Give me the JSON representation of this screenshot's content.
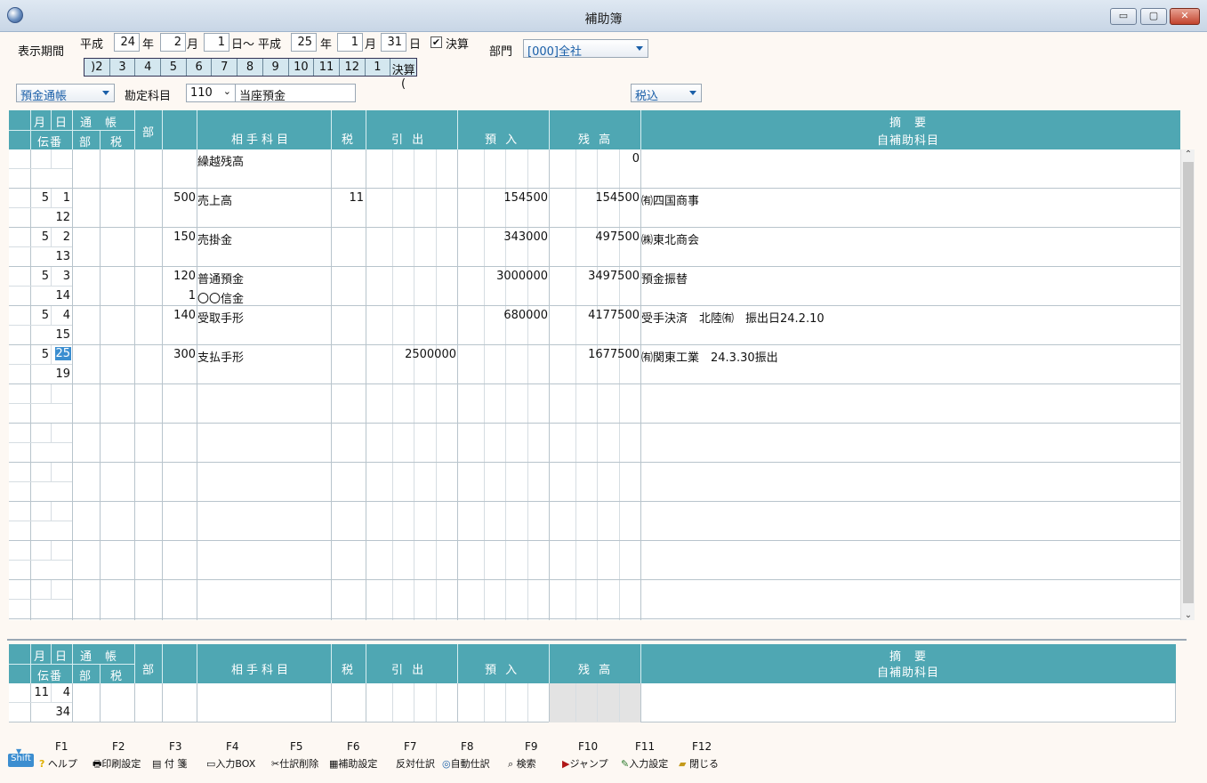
{
  "window": {
    "title": "補助簿",
    "min_glyph": "▭",
    "max_glyph": "▢",
    "close_glyph": "✕"
  },
  "period": {
    "label": "表示期間",
    "era1": "平成",
    "year1": "24",
    "year_unit": "年",
    "month1": "2",
    "month_unit": "月",
    "day1": "1",
    "day_unit": "日～",
    "era2": "平成",
    "year2": "25",
    "month2": "1",
    "day2": "31",
    "day_unit2": "日",
    "settle_checked": "✔",
    "settle_label": "決算"
  },
  "months": [
    ")2",
    "3",
    "4",
    "5",
    "6",
    "7",
    "8",
    "9",
    "10",
    "11",
    "12",
    "1",
    "決算("
  ],
  "department": {
    "label": "部門",
    "value": "[000]全社"
  },
  "ledger_type": "預金通帳",
  "account": {
    "label": "勘定科目",
    "code": "110",
    "name": "当座預金"
  },
  "tax_mode": "税込",
  "headers": {
    "month": "月",
    "day": "日",
    "passbook": "通　帳",
    "slip": "伝番",
    "dept_sub": "部",
    "tax_sub": "税",
    "dept": "部",
    "counter_account": "相手科目",
    "tax": "税",
    "withdraw": "引 出",
    "deposit": "預 入",
    "balance": "残 高",
    "memo": "摘　要",
    "sub_account": "自補助科目"
  },
  "rows": [
    {
      "m": "",
      "d": "",
      "slip": "",
      "code": "",
      "acct": "繰越残高",
      "code2": "",
      "acct2": "",
      "tax": "",
      "withdraw": "",
      "deposit": "",
      "balance": "0",
      "memo": ""
    },
    {
      "m": "5",
      "d": "1",
      "slip": "12",
      "code": "500",
      "acct": "売上高",
      "code2": "",
      "acct2": "",
      "tax": "11",
      "withdraw": "",
      "deposit": "154500",
      "balance": "154500",
      "memo": "㈲四国商事"
    },
    {
      "m": "5",
      "d": "2",
      "slip": "13",
      "code": "150",
      "acct": "売掛金",
      "code2": "",
      "acct2": "",
      "tax": "",
      "withdraw": "",
      "deposit": "343000",
      "balance": "497500",
      "memo": "㈱東北商会"
    },
    {
      "m": "5",
      "d": "3",
      "slip": "14",
      "code": "120",
      "acct": "普通預金",
      "code2": "1",
      "acct2": "〇〇信金",
      "tax": "",
      "withdraw": "",
      "deposit": "3000000",
      "balance": "3497500",
      "memo": "預金振替"
    },
    {
      "m": "5",
      "d": "4",
      "slip": "15",
      "code": "140",
      "acct": "受取手形",
      "code2": "",
      "acct2": "",
      "tax": "",
      "withdraw": "",
      "deposit": "680000",
      "balance": "4177500",
      "memo": "受手決済　北陸㈲　振出日24.2.10"
    },
    {
      "m": "5",
      "d": "25",
      "slip": "19",
      "code": "300",
      "acct": "支払手形",
      "code2": "",
      "acct2": "",
      "tax": "",
      "withdraw": "2500000",
      "deposit": "",
      "balance": "1677500",
      "memo": "㈲関東工業　24.3.30振出"
    }
  ],
  "entry": {
    "m": "11",
    "d": "4",
    "slip": "34"
  },
  "fkeys": [
    {
      "key": "F1",
      "label": "ヘルプ",
      "icon": "help-icon",
      "glyph": "?"
    },
    {
      "key": "F2",
      "label": "印刷設定",
      "icon": "printer-icon",
      "glyph": "🖶"
    },
    {
      "key": "F3",
      "label": "付 箋",
      "icon": "sticky-note-icon",
      "glyph": "▤"
    },
    {
      "key": "F4",
      "label": "入力BOX",
      "icon": "window-icon",
      "glyph": "▭"
    },
    {
      "key": "F5",
      "label": "仕訳削除",
      "icon": "scissors-icon",
      "glyph": "✂"
    },
    {
      "key": "F6",
      "label": "補助設定",
      "icon": "list-icon",
      "glyph": "▦"
    },
    {
      "key": "F7",
      "label": "反対仕訳",
      "icon": "",
      "glyph": ""
    },
    {
      "key": "F8",
      "label": "自動仕訳",
      "icon": "auto-icon",
      "glyph": "◎"
    },
    {
      "key": "F9",
      "label": "検索",
      "icon": "binoculars-icon",
      "glyph": "⌕"
    },
    {
      "key": "F10",
      "label": "ジャンプ",
      "icon": "jump-icon",
      "glyph": "▶"
    },
    {
      "key": "F11",
      "label": "入力設定",
      "icon": "edit-icon",
      "glyph": "✎"
    },
    {
      "key": "F12",
      "label": "閉じる",
      "icon": "folder-icon",
      "glyph": "▰"
    }
  ],
  "shift_label": "Shift",
  "scroll": {
    "up": "⌃",
    "down": "⌄"
  }
}
